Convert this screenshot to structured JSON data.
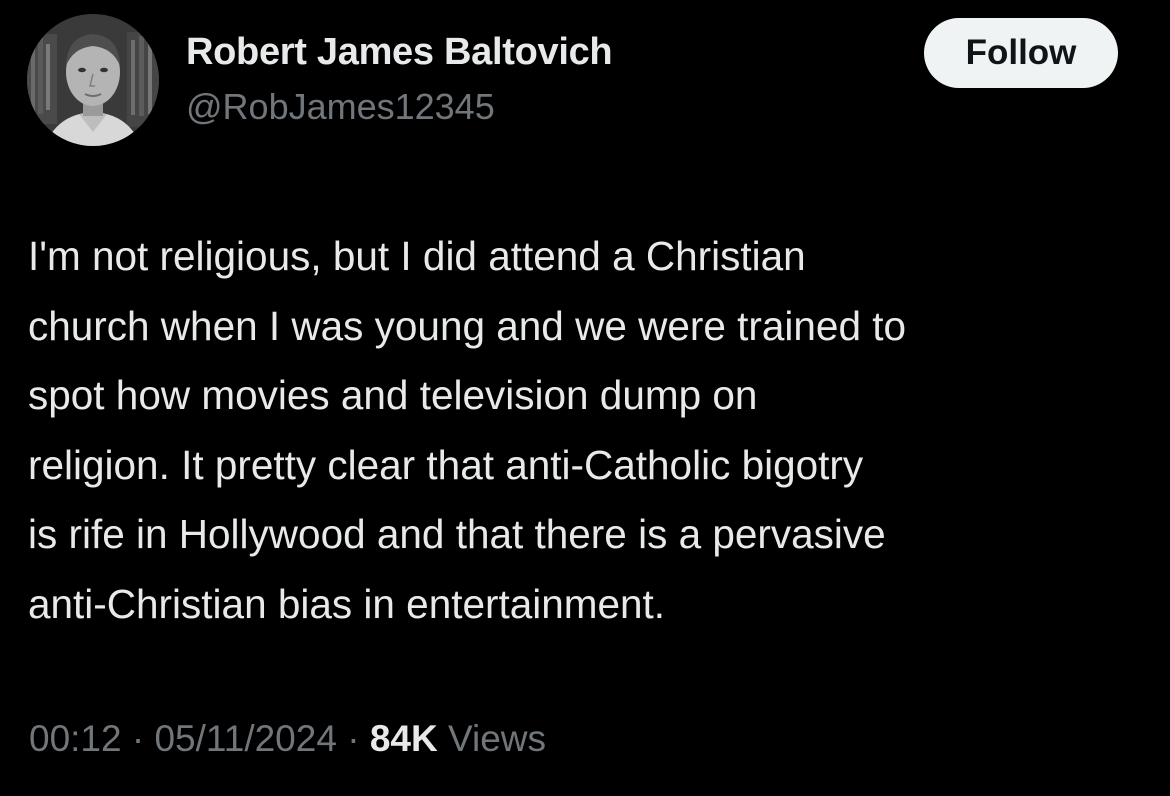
{
  "author": {
    "display_name": "Robert James Baltovich",
    "handle": "@RobJames12345"
  },
  "follow_button": {
    "label": "Follow"
  },
  "tweet": {
    "lines": [
      "I'm not religious, but I did attend a Christian",
      "church when I was young and we were trained to",
      "spot how movies and television dump on",
      "religion. It pretty clear that anti-Catholic bigotry",
      "is rife in Hollywood and that there is a pervasive",
      "anti-Christian bias in entertainment."
    ]
  },
  "meta": {
    "time": "00:12",
    "separator": "·",
    "date": "05/11/2024",
    "views_count": "84K",
    "views_label": "Views"
  },
  "colors": {
    "background": "#000000",
    "primary_text": "#e7e9ea",
    "secondary_text": "#71767b",
    "follow_button_bg": "#eff3f4",
    "follow_button_text": "#0f1419"
  }
}
